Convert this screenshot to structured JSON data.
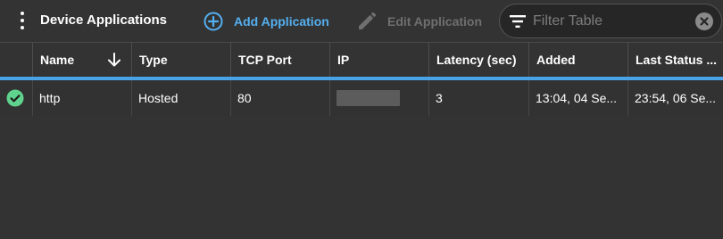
{
  "toolbar": {
    "title": "Device Applications",
    "add_label": "Add Application",
    "edit_label": "Edit Application",
    "filter_placeholder": "Filter Table"
  },
  "table": {
    "columns": [
      {
        "key": "status",
        "label": ""
      },
      {
        "key": "name",
        "label": "Name",
        "sorted": "descending"
      },
      {
        "key": "type",
        "label": "Type"
      },
      {
        "key": "tcp_port",
        "label": "TCP Port"
      },
      {
        "key": "ip",
        "label": "IP"
      },
      {
        "key": "latency",
        "label": "Latency (sec)"
      },
      {
        "key": "added",
        "label": "Added"
      },
      {
        "key": "last_status",
        "label": "Last Status ..."
      }
    ],
    "rows": [
      {
        "status": "ok",
        "name": "http",
        "type": "Hosted",
        "tcp_port": "80",
        "ip": "",
        "latency": "3",
        "added": "13:04, 04 Se...",
        "last_status": "23:54, 06 Se..."
      }
    ]
  },
  "colors": {
    "background": "#333333",
    "accent": "#54aff0",
    "header_underline": "#4aa3e6",
    "status_ok": "#5fd38d",
    "disabled_text": "#6f6f6f"
  },
  "icons": {
    "menu": "kebab-menu-icon",
    "add": "plus-circle-icon",
    "edit": "pencil-icon",
    "filter": "filter-lines-icon",
    "clear": "close-circle-icon",
    "sort": "arrow-down-icon",
    "status": "check-circle-icon"
  }
}
